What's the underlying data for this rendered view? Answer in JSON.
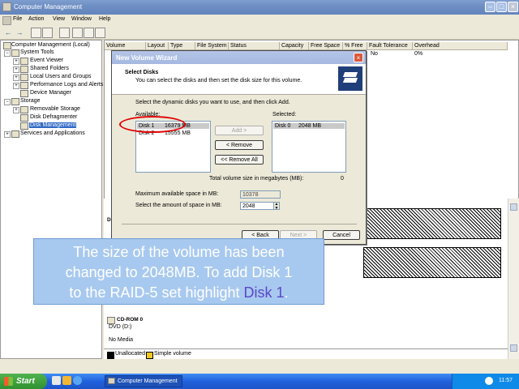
{
  "window": {
    "title": "Computer Management"
  },
  "menu": [
    "File",
    "Action",
    "View",
    "Window",
    "Help"
  ],
  "tree": [
    {
      "label": "Computer Management (Local)",
      "icon": "computer-icon"
    },
    {
      "label": "System Tools",
      "icon": "tools-icon"
    },
    {
      "label": "Event Viewer",
      "icon": "event-viewer-icon"
    },
    {
      "label": "Shared Folders",
      "icon": "shared-folder-icon"
    },
    {
      "label": "Local Users and Groups",
      "icon": "users-icon"
    },
    {
      "label": "Performance Logs and Alerts",
      "icon": "performance-icon"
    },
    {
      "label": "Device Manager",
      "icon": "device-manager-icon"
    },
    {
      "label": "Storage",
      "icon": "storage-icon"
    },
    {
      "label": "Removable Storage",
      "icon": "removable-storage-icon"
    },
    {
      "label": "Disk Defragmenter",
      "icon": "defrag-icon"
    },
    {
      "label": "Disk Management",
      "icon": "disk-management-icon"
    },
    {
      "label": "Services and Applications",
      "icon": "services-icon"
    }
  ],
  "columns": [
    "Volume",
    "Layout",
    "Type",
    "File System",
    "Status",
    "Capacity",
    "Free Space",
    "% Free",
    "Fault Tolerance",
    "Overhead"
  ],
  "volume_row": {
    "fault_tolerance": "No",
    "overhead": "0%"
  },
  "lower": {
    "cdrom_label": "CD-ROM 0",
    "cdrom_type": "DVD (D:)",
    "cdrom_status": "No Media",
    "disk_partial": "D"
  },
  "legend": {
    "unallocated": "Unallocated",
    "simple": "Simple volume"
  },
  "dialog": {
    "title": "New Volume Wizard",
    "heading": "Select Disks",
    "subheading": "You can select the disks and then set the disk size for this volume.",
    "instruction": "Select the dynamic disks you want to use, and then click Add.",
    "available_label": "Available:",
    "selected_label": "Selected:",
    "available": [
      {
        "disk": "Disk 1",
        "size": "16379 MB"
      },
      {
        "disk": "Disk 2",
        "size": "15555 MB"
      }
    ],
    "selected": [
      {
        "disk": "Disk 0",
        "size": "2048 MB"
      }
    ],
    "add_button": "Add >",
    "remove_button": "< Remove",
    "remove_all_button": "<< Remove All",
    "total_label": "Total volume size in megabytes (MB):",
    "total_value": "0",
    "max_label": "Maximum available space in MB:",
    "max_value": "10378",
    "amount_label": "Select the amount of space in MB:",
    "amount_value": "2048",
    "back_button": "< Back",
    "next_button": "Next >",
    "cancel_button": "Cancel"
  },
  "caption": {
    "line1": "The size of the volume has been",
    "line2": "changed to 2048MB. To add Disk 1",
    "line3_prefix": "to the RAID-5 set highlight ",
    "line3_highlight": "Disk 1",
    "line3_suffix": "."
  },
  "taskbar": {
    "start": "Start",
    "task": "Computer Management",
    "language": "EN",
    "time": "11:57"
  },
  "colors": {
    "annotation_ring": "#e00000",
    "caption_bg": "#a8c9ef",
    "caption_highlight": "#5a46c8"
  }
}
